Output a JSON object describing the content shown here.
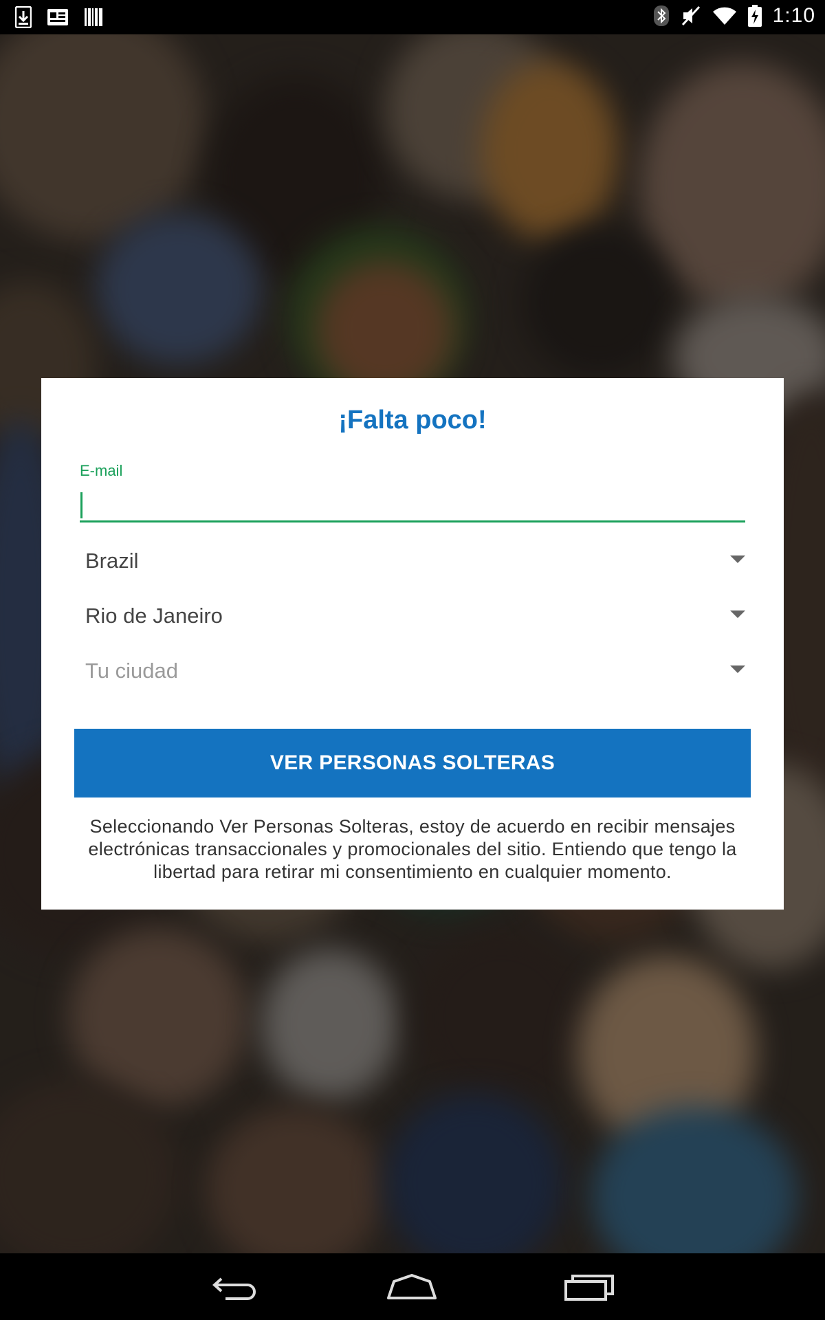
{
  "status_bar": {
    "time": "1:10",
    "left_icons": [
      "download-icon",
      "news-icon",
      "barcode-icon"
    ],
    "right_icons": [
      "bluetooth-icon",
      "mute-icon",
      "wifi-icon",
      "battery-charging-icon"
    ]
  },
  "dialog": {
    "title": "¡Falta poco!",
    "email": {
      "label": "E-mail",
      "value": ""
    },
    "selects": [
      {
        "value": "Brazil"
      },
      {
        "value": "Rio de Janeiro"
      },
      {
        "value": "Tu ciudad"
      }
    ],
    "submit_label": "VER PERSONAS SOLTERAS",
    "consent": "Seleccionando Ver Personas Solteras, estoy de acuerdo en recibir mensajes electrónicas transaccionales y promocionales del sitio. Entiendo que tengo la libertad para retirar mi consentimiento en cualquier momento."
  },
  "nav_bar": {
    "icons": [
      "back-icon",
      "home-icon",
      "recent-apps-icon"
    ]
  },
  "colors": {
    "accent_blue": "#1473c0",
    "field_green": "#1aa05a"
  }
}
